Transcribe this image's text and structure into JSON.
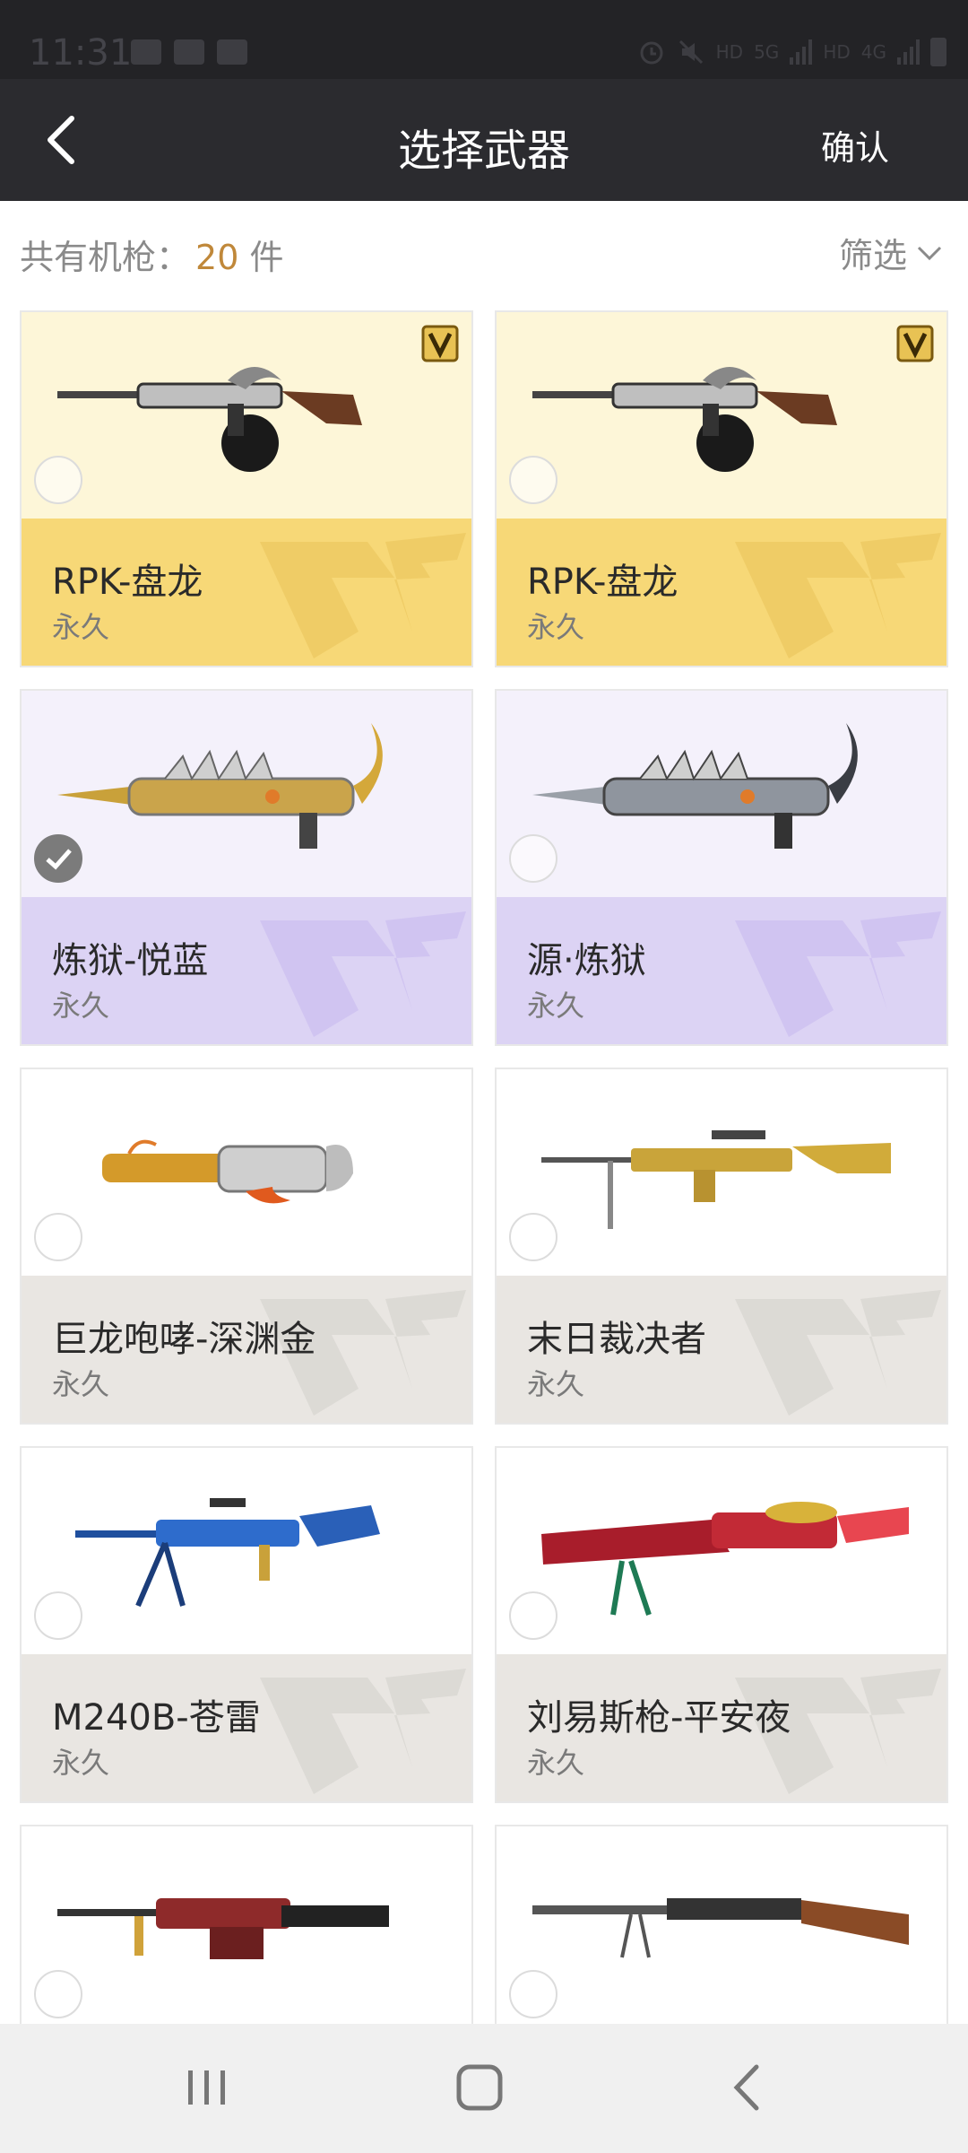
{
  "status_bar": {
    "time": "11:31",
    "icons": [
      "message-icon",
      "camera-icon",
      "image-icon",
      "alarm-icon",
      "mute-icon",
      "signal-icon",
      "battery-icon"
    ],
    "net_labels": [
      "HD",
      "5G",
      "HD",
      "4G"
    ]
  },
  "header": {
    "title": "选择武器",
    "confirm_label": "确认"
  },
  "summary": {
    "prefix": "共有机枪：",
    "count": "20",
    "unit": "件",
    "filter_label": "筛选"
  },
  "weapons": [
    {
      "name": "RPK-盘龙",
      "duration": "永久",
      "tier": "gold",
      "vip": true,
      "selected": false,
      "icon": "rpk-dragon-rifle-icon"
    },
    {
      "name": "RPK-盘龙",
      "duration": "永久",
      "tier": "gold",
      "vip": true,
      "selected": false,
      "icon": "rpk-dragon-rifle-icon"
    },
    {
      "name": "炼狱-悦蓝",
      "duration": "永久",
      "tier": "purple",
      "vip": false,
      "selected": true,
      "icon": "inferno-gun-gold-icon"
    },
    {
      "name": "源·炼狱",
      "duration": "永久",
      "tier": "purple",
      "vip": false,
      "selected": false,
      "icon": "inferno-gun-steel-icon"
    },
    {
      "name": "巨龙咆哮-深渊金",
      "duration": "永久",
      "tier": "plain",
      "vip": false,
      "selected": false,
      "icon": "dragon-roar-gun-icon"
    },
    {
      "name": "末日裁决者",
      "duration": "永久",
      "tier": "plain",
      "vip": false,
      "selected": false,
      "icon": "golden-mg-icon"
    },
    {
      "name": "M240B-苍雷",
      "duration": "永久",
      "tier": "plain",
      "vip": false,
      "selected": false,
      "icon": "blue-m240b-icon"
    },
    {
      "name": "刘易斯枪-平安夜",
      "duration": "永久",
      "tier": "plain",
      "vip": false,
      "selected": false,
      "icon": "christmas-lewis-gun-icon"
    },
    {
      "name": "",
      "duration": "",
      "tier": "plain",
      "vip": false,
      "selected": false,
      "icon": "red-m249-icon"
    },
    {
      "name": "",
      "duration": "",
      "tier": "plain",
      "vip": false,
      "selected": false,
      "icon": "vintage-mg-icon"
    }
  ],
  "colors": {
    "header_bg": "#2b2b2f",
    "count_accent": "#c0883a",
    "gold_card": "#f7d877",
    "purple_card": "#dcd3f4",
    "plain_card": "#e9e6e2"
  },
  "bottom_nav": {
    "icons": [
      "recents-icon",
      "home-icon",
      "back-icon"
    ]
  }
}
